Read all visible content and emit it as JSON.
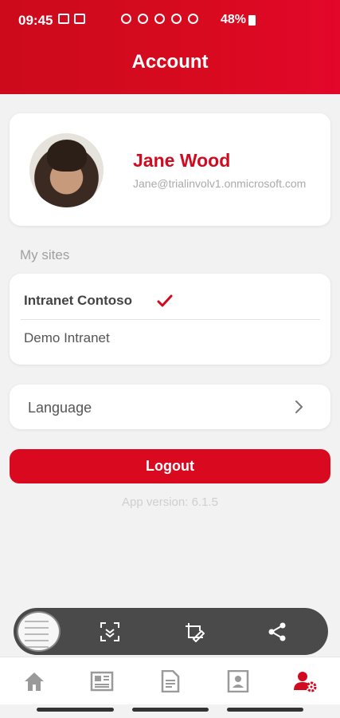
{
  "status_bar": {
    "time": "09:45",
    "battery": "48%"
  },
  "header": {
    "title": "Account"
  },
  "profile": {
    "name": "Jane Wood",
    "email": "Jane@trialinvolv1.onmicrosoft.com"
  },
  "sites": {
    "section_label": "My sites",
    "items": [
      {
        "label": "Intranet Contoso",
        "selected": true
      },
      {
        "label": "Demo Intranet",
        "selected": false
      }
    ]
  },
  "language": {
    "label": "Language"
  },
  "logout": {
    "label": "Logout"
  },
  "version": "App version: 6.1.5",
  "floating_toolbar": {
    "icons": [
      "scan-icon",
      "edit-screenshot-icon",
      "share-icon"
    ]
  },
  "tab_bar": {
    "tabs": [
      "home-icon",
      "news-icon",
      "document-icon",
      "contact-icon",
      "account-settings-icon"
    ],
    "active": "account-settings-icon"
  },
  "colors": {
    "brand": "#d90a20",
    "background": "#f2f2f2",
    "muted": "#a0a0a0"
  }
}
